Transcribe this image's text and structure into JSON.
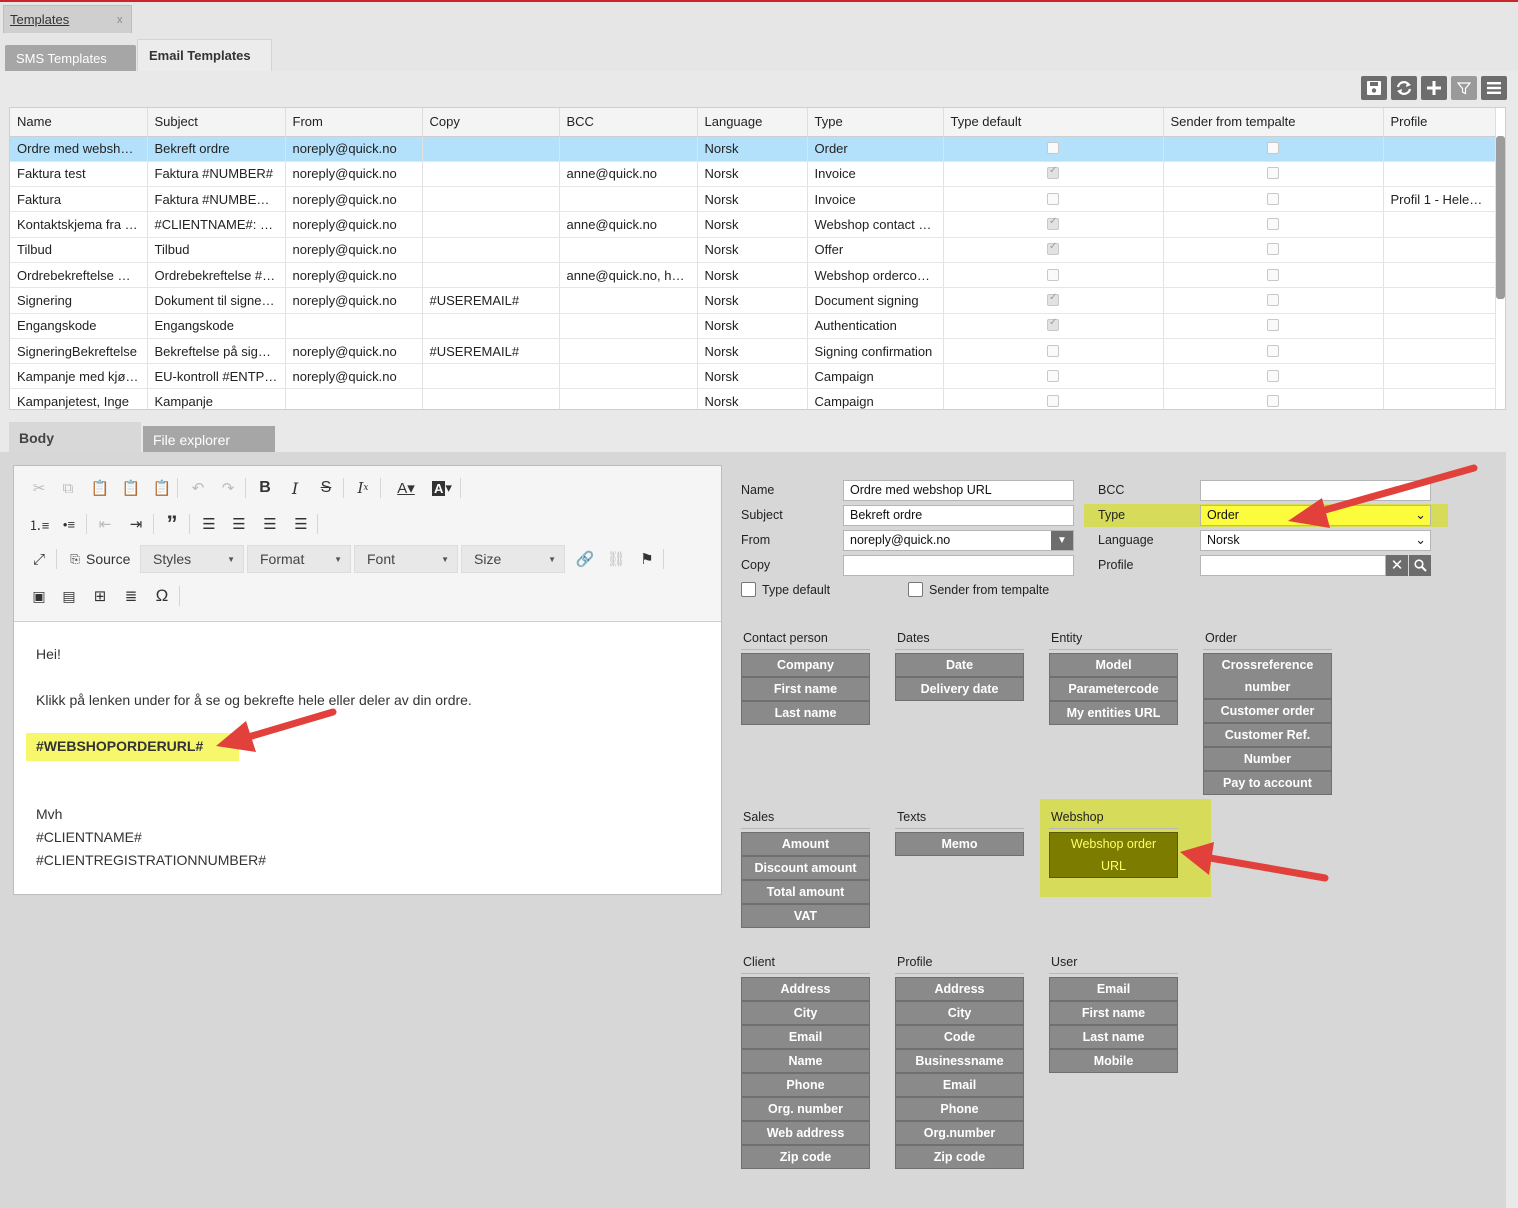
{
  "window": {
    "tab_label": "Templates",
    "tab_close": "x"
  },
  "tabs": [
    "SMS Templates",
    "Email Templates"
  ],
  "toolbar_icons": [
    "save-icon",
    "refresh-icon",
    "add-icon",
    "filter-icon",
    "menu-icon"
  ],
  "grid": {
    "columns": [
      "Name",
      "Subject",
      "From",
      "Copy",
      "BCC",
      "Language",
      "Type",
      "Type default",
      "Sender from tempalte",
      "Profile"
    ],
    "rows": [
      {
        "name": "Ordre med websho…",
        "subject": "Bekreft ordre",
        "from": "noreply@quick.no",
        "copy": "",
        "bcc": "",
        "language": "Norsk",
        "type": "Order",
        "type_default": false,
        "sender": false,
        "profile": ""
      },
      {
        "name": "Faktura test",
        "subject": "Faktura #NUMBER#",
        "from": "noreply@quick.no",
        "copy": "",
        "bcc": "anne@quick.no",
        "language": "Norsk",
        "type": "Invoice",
        "type_default": true,
        "sender": false,
        "profile": ""
      },
      {
        "name": "Faktura",
        "subject": "Faktura #NUMBER…",
        "from": "noreply@quick.no",
        "copy": "",
        "bcc": "",
        "language": "Norsk",
        "type": "Invoice",
        "type_default": false,
        "sender": false,
        "profile": "Profil 1 - Helen…"
      },
      {
        "name": "Kontaktskjema fra …",
        "subject": "#CLIENTNAME#: V…",
        "from": "noreply@quick.no",
        "copy": "",
        "bcc": "anne@quick.no",
        "language": "Norsk",
        "type": "Webshop contact r…",
        "type_default": true,
        "sender": false,
        "profile": ""
      },
      {
        "name": "Tilbud",
        "subject": "Tilbud",
        "from": "noreply@quick.no",
        "copy": "",
        "bcc": "",
        "language": "Norsk",
        "type": "Offer",
        "type_default": true,
        "sender": false,
        "profile": ""
      },
      {
        "name": "Ordrebekreftelse w…",
        "subject": "Ordrebekreftelse #…",
        "from": "noreply@quick.no",
        "copy": "",
        "bcc": "anne@quick.no, hel…",
        "language": "Norsk",
        "type": "Webshop ordercon…",
        "type_default": false,
        "sender": false,
        "profile": ""
      },
      {
        "name": "Signering",
        "subject": "Dokument til signer…",
        "from": "noreply@quick.no",
        "copy": "#USEREMAIL#",
        "bcc": "",
        "language": "Norsk",
        "type": "Document signing",
        "type_default": true,
        "sender": false,
        "profile": ""
      },
      {
        "name": "Engangskode",
        "subject": "Engangskode",
        "from": "",
        "copy": "",
        "bcc": "",
        "language": "Norsk",
        "type": "Authentication",
        "type_default": true,
        "sender": false,
        "profile": ""
      },
      {
        "name": "SigneringBekreftelse",
        "subject": "Bekreftelse på sign…",
        "from": "noreply@quick.no",
        "copy": "#USEREMAIL#",
        "bcc": "",
        "language": "Norsk",
        "type": "Signing confirmation",
        "type_default": false,
        "sender": false,
        "profile": ""
      },
      {
        "name": "Kampanje med kjør…",
        "subject": "EU-kontroll #ENTP…",
        "from": "noreply@quick.no",
        "copy": "",
        "bcc": "",
        "language": "Norsk",
        "type": "Campaign",
        "type_default": false,
        "sender": false,
        "profile": ""
      },
      {
        "name": "Kampanjetest, Inge",
        "subject": "Kampanje",
        "from": "",
        "copy": "",
        "bcc": "",
        "language": "Norsk",
        "type": "Campaign",
        "type_default": false,
        "sender": false,
        "profile": ""
      }
    ]
  },
  "body_tabs": [
    "Body",
    "File explorer"
  ],
  "editor": {
    "source_label": "Source",
    "styles_label": "Styles",
    "format_label": "Format",
    "font_label": "Font",
    "size_label": "Size",
    "lines": [
      "Hei!",
      "Klikk på lenken under for å se og bekrefte hele eller deler av din ordre.",
      "#WEBSHOPORDERURL#",
      "Mvh",
      "#CLIENTNAME#",
      "#CLIENTREGISTRATIONNUMBER#"
    ]
  },
  "form": {
    "name_label": "Name",
    "name_value": "Ordre med webshop URL",
    "subject_label": "Subject",
    "subject_value": "Bekreft ordre",
    "from_label": "From",
    "from_value": "noreply@quick.no",
    "copy_label": "Copy",
    "copy_value": "",
    "bcc_label": "BCC",
    "bcc_value": "",
    "type_label": "Type",
    "type_value": "Order",
    "language_label": "Language",
    "language_value": "Norsk",
    "profile_label": "Profile",
    "profile_value": "",
    "type_default_label": "Type default",
    "sender_label": "Sender from tempalte"
  },
  "placeholders": {
    "contact_person": {
      "title": "Contact person",
      "items": [
        "Company",
        "First name",
        "Last name"
      ]
    },
    "dates": {
      "title": "Dates",
      "items": [
        "Date",
        "Delivery date"
      ]
    },
    "entity": {
      "title": "Entity",
      "items": [
        "Model",
        "Parametercode",
        "My entities URL"
      ]
    },
    "order": {
      "title": "Order",
      "items": [
        "Crossreference number",
        "Customer order",
        "Customer Ref.",
        "Number",
        "Pay to account"
      ]
    },
    "sales": {
      "title": "Sales",
      "items": [
        "Amount",
        "Discount amount",
        "Total amount",
        "VAT"
      ]
    },
    "texts": {
      "title": "Texts",
      "items": [
        "Memo"
      ]
    },
    "webshop": {
      "title": "Webshop",
      "items": [
        "Webshop order URL"
      ]
    },
    "client": {
      "title": "Client",
      "items": [
        "Address",
        "City",
        "Email",
        "Name",
        "Phone",
        "Org. number",
        "Web address",
        "Zip code"
      ]
    },
    "profile": {
      "title": "Profile",
      "items": [
        "Address",
        "City",
        "Code",
        "Businessname",
        "Email",
        "Phone",
        "Org.number",
        "Zip code"
      ]
    },
    "user": {
      "title": "User",
      "items": [
        "Email",
        "First name",
        "Last name",
        "Mobile"
      ]
    }
  },
  "colors": {
    "accent_red": "#c8262b",
    "selected_row": "#b3e0fb",
    "highlight": "#d6dc5a",
    "button_gray": "#8a8a8a",
    "webshop_button": "#7c7c00",
    "arrow": "#e2403b"
  }
}
